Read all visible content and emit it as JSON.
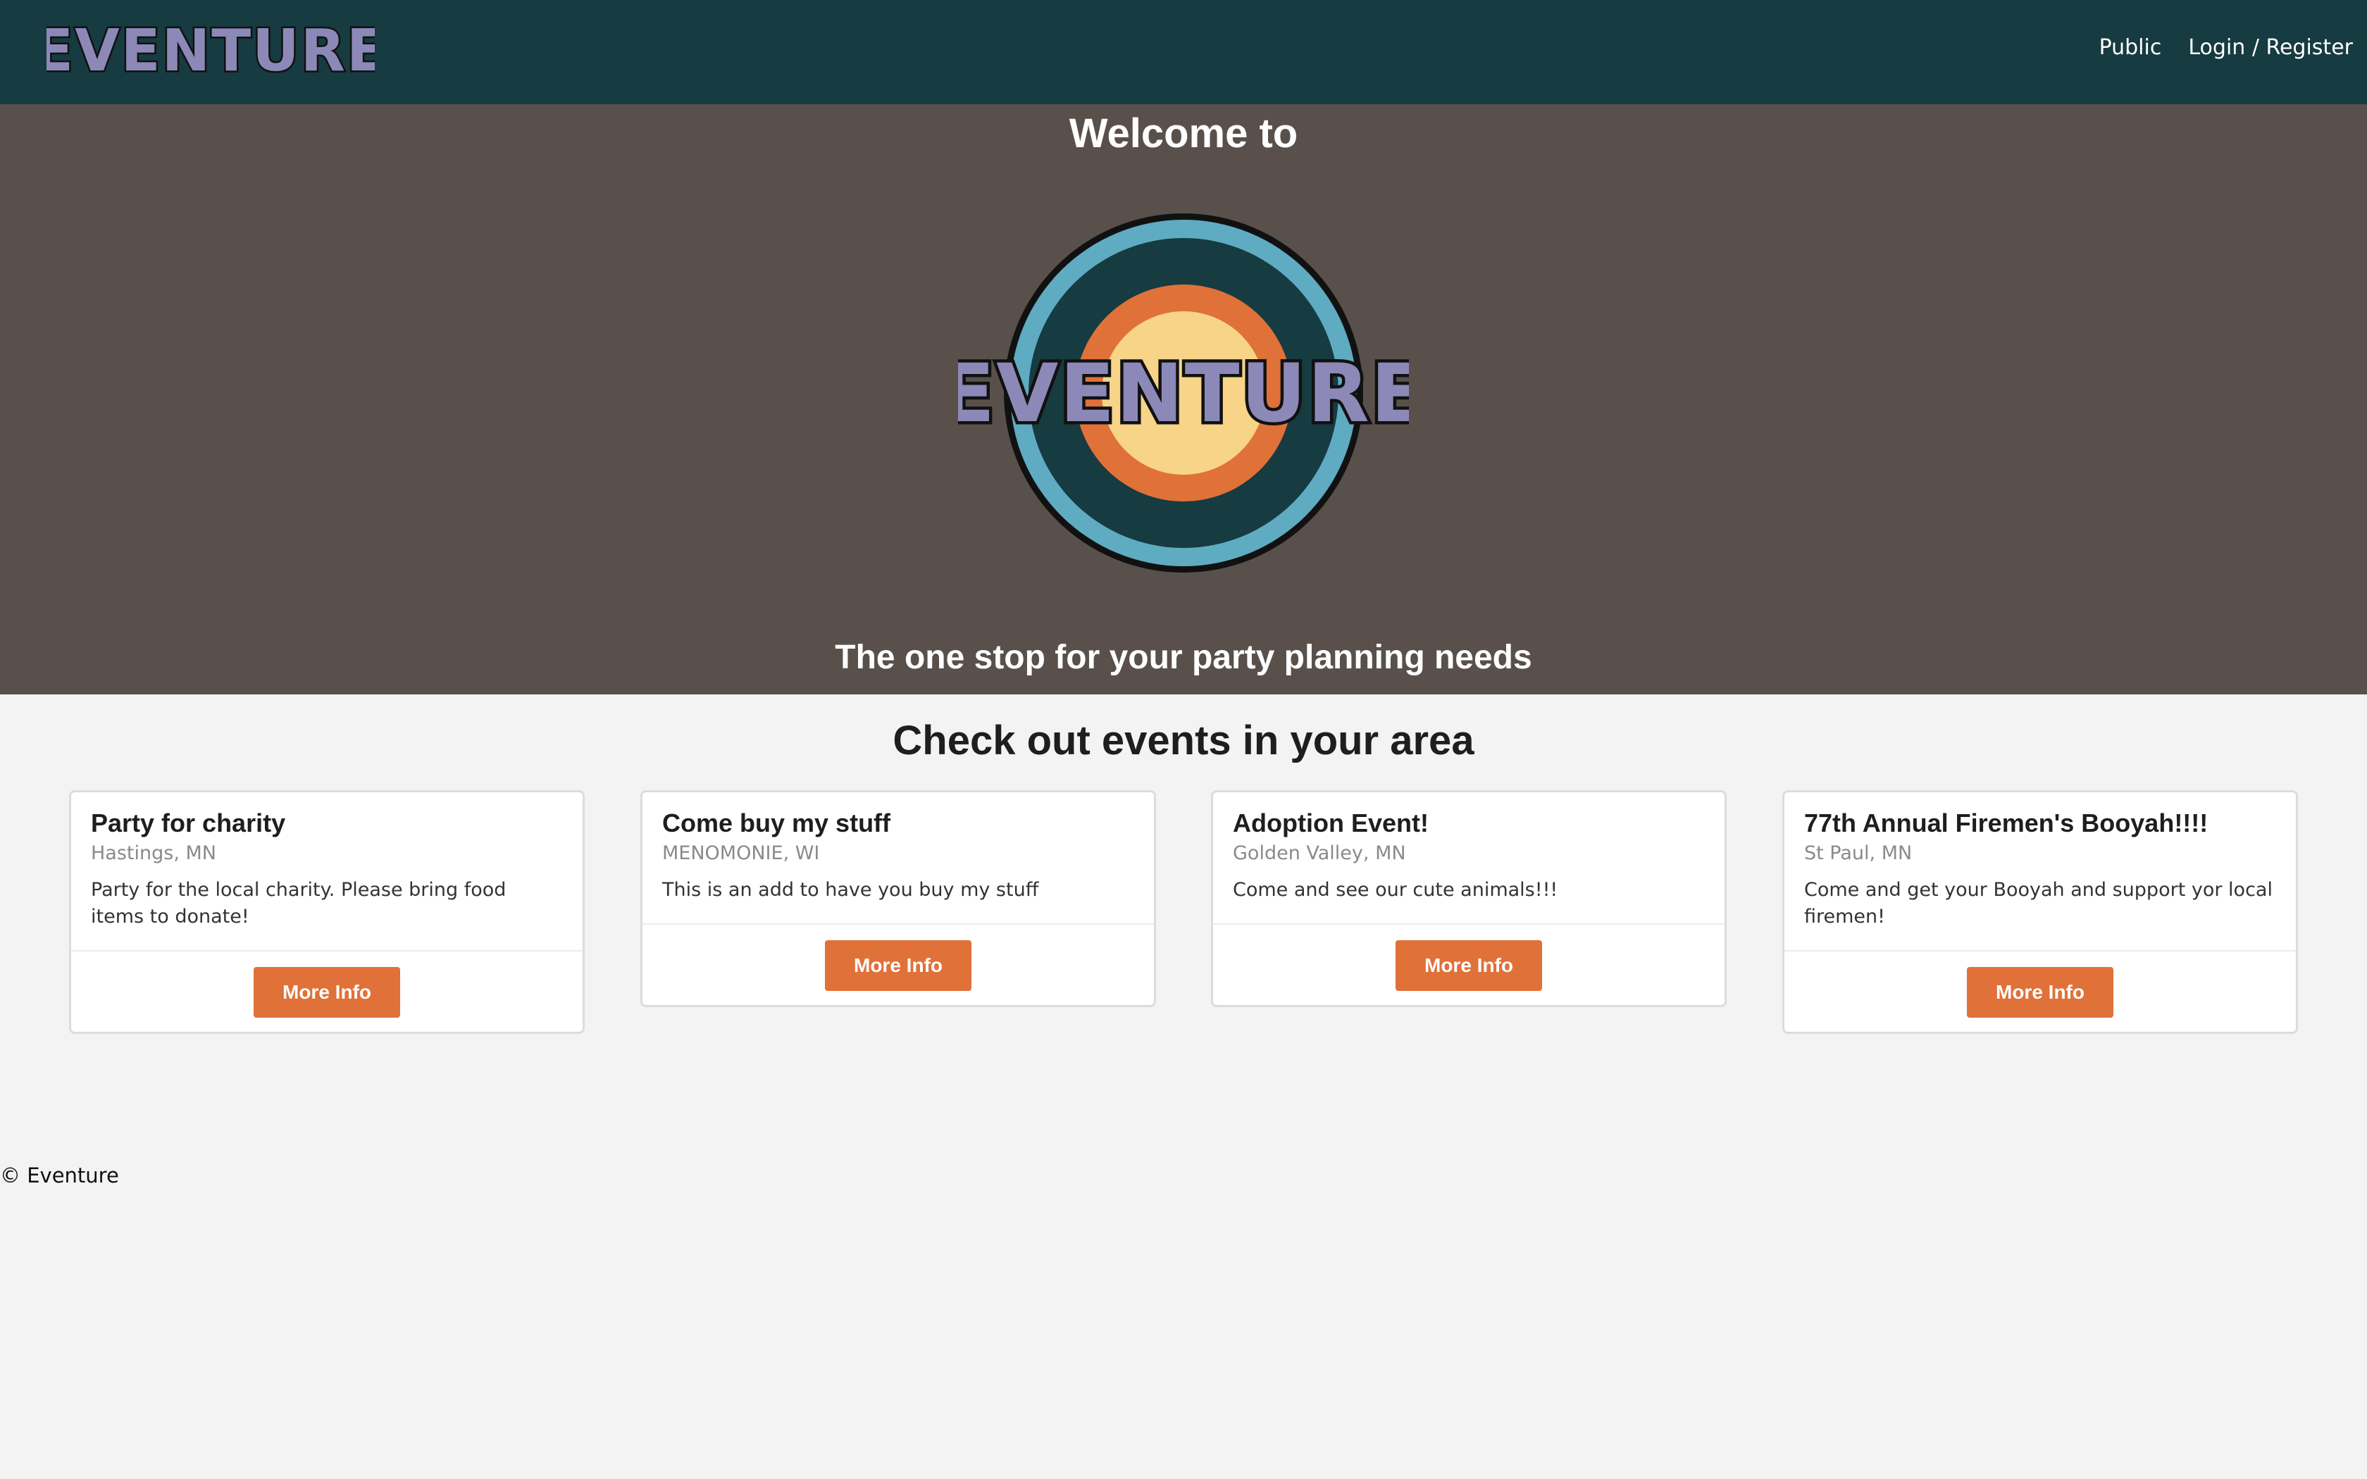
{
  "brand": {
    "name": "EVENTURE",
    "logo_fill": "#8c89b8",
    "logo_stroke": "#111111"
  },
  "nav": {
    "links": [
      {
        "label": "Public"
      },
      {
        "label": "Login / Register"
      }
    ]
  },
  "hero": {
    "welcome": "Welcome to",
    "tagline": "The one stop for your party planning needs",
    "logo_colors": {
      "outer_ring": "#5fabc2",
      "dark_ring": "#163b41",
      "orange_ring": "#e07139",
      "center": "#f8d488"
    }
  },
  "events": {
    "heading": "Check out events in your area",
    "cards": [
      {
        "title": "Party for charity",
        "location": "Hastings, MN",
        "description": "Party for the local charity. Please bring food items to donate!",
        "button": "More Info"
      },
      {
        "title": "Come buy my stuff",
        "location": "MENOMONIE, WI",
        "description": "This is an add to have you buy my stuff",
        "button": "More Info"
      },
      {
        "title": "Adoption Event!",
        "location": "Golden Valley, MN",
        "description": "Come and see our cute animals!!!",
        "button": "More Info"
      },
      {
        "title": "77th Annual Firemen's Booyah!!!!",
        "location": "St Paul, MN",
        "description": "Come and get your Booyah and support yor local firemen!",
        "button": "More Info"
      }
    ]
  },
  "footer": {
    "copyright": "© Eventure"
  },
  "colors": {
    "navbar": "#163b41",
    "hero_bg": "#59504c",
    "page_bg": "#f2f3f2",
    "accent": "#e07139"
  }
}
